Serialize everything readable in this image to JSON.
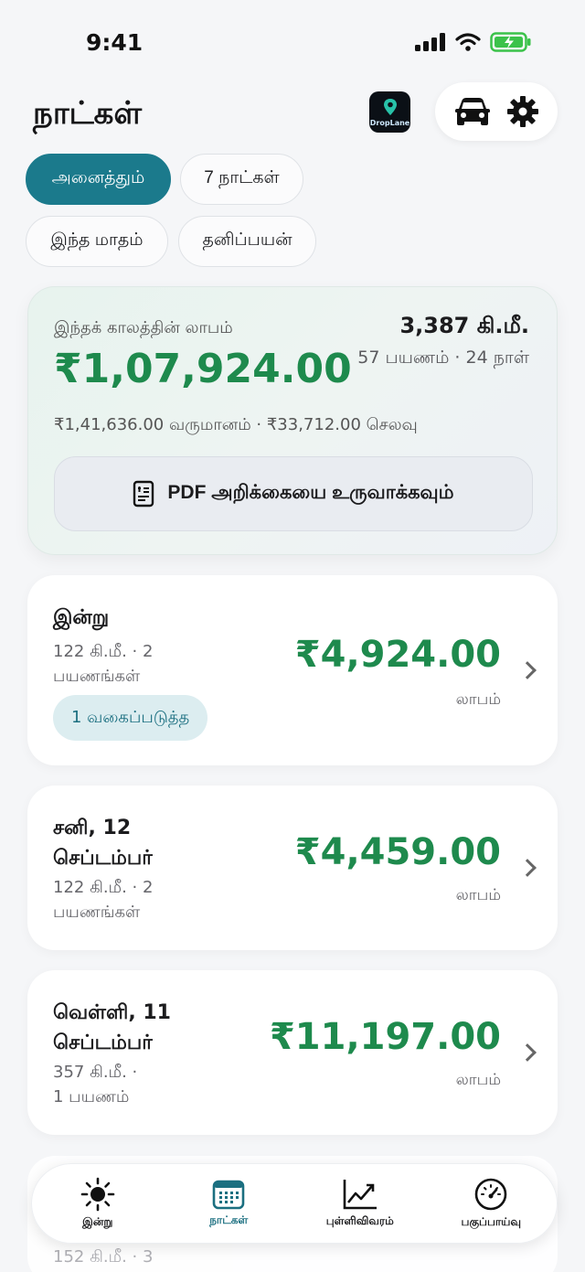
{
  "status_bar": {
    "time": "9:41"
  },
  "header": {
    "title": "நாட்கள்",
    "logo_text": "DropLane"
  },
  "filters": [
    {
      "label": "அனைத்தும்",
      "active": true
    },
    {
      "label": "7 நாட்கள்",
      "active": false
    },
    {
      "label": "இந்த மாதம்",
      "active": false
    },
    {
      "label": "தனிப்பயன்",
      "active": false
    }
  ],
  "summary": {
    "label": "இந்தக் காலத்தின் லாபம்",
    "profit": "₹1,07,924.00",
    "distance": "3,387 கி.மீ.",
    "trips_days": "57 பயணம் · 24 நாள்",
    "revenue_expense": "₹1,41,636.00 வருமானம் · ₹33,712.00 செலவு",
    "pdf_button": "PDF அறிக்கையை உருவாக்கவும்"
  },
  "days": [
    {
      "title": "இன்று",
      "sub1": "122 கி.மீ. · 2",
      "sub2": "பயணங்கள்",
      "amount": "₹4,924.00",
      "profit_label": "லாபம்",
      "tag": "1 வகைப்படுத்த"
    },
    {
      "title1": "சனி, 12",
      "title2": "செப்டம்பர்",
      "sub1": "122 கி.மீ. · 2",
      "sub2": "பயணங்கள்",
      "amount": "₹4,459.00",
      "profit_label": "லாபம்"
    },
    {
      "title1": "வெள்ளி, 11",
      "title2": "செப்டம்பர்",
      "sub1": "357 கி.மீ. ·",
      "sub2": "1 பயணம்",
      "amount": "₹11,197.00",
      "profit_label": "லாபம்"
    }
  ],
  "partial_day": {
    "sub": "152 கி.மீ. · 3"
  },
  "nav": [
    {
      "label": "இன்று",
      "icon": "sun-icon",
      "active": false
    },
    {
      "label": "நாட்கள்",
      "icon": "calendar-icon",
      "active": true
    },
    {
      "label": "புள்ளிவிவரம்",
      "icon": "chart-icon",
      "active": false
    },
    {
      "label": "பகுப்பாய்வு",
      "icon": "gauge-icon",
      "active": false
    }
  ],
  "colors": {
    "accent": "#1b7a8c",
    "profit": "#1e8a4d",
    "tag_bg": "#dcedf0"
  }
}
